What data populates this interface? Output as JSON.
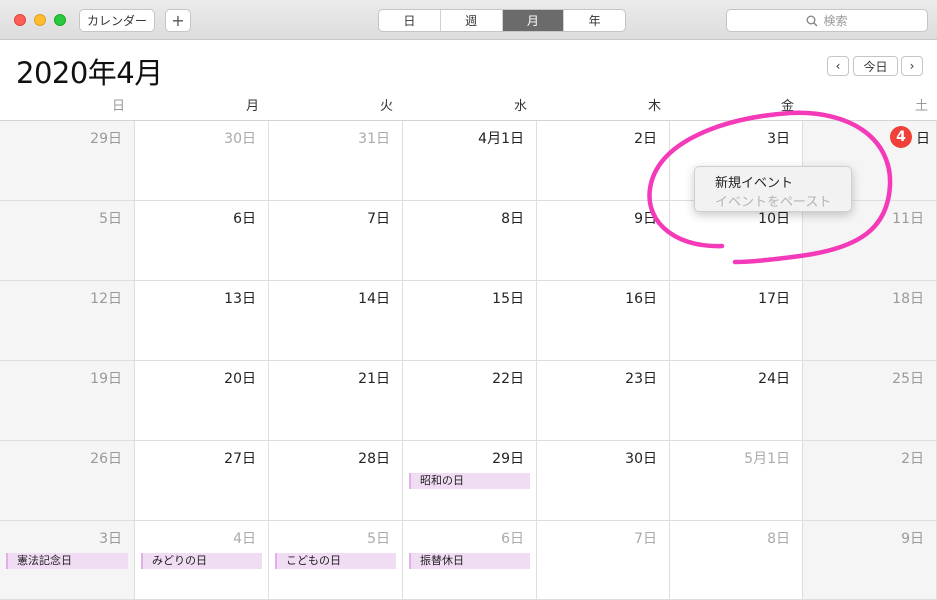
{
  "toolbar": {
    "calendars_label": "カレンダー",
    "add_label": "+",
    "view_tabs": [
      "日",
      "週",
      "月",
      "年"
    ],
    "active_view": "月",
    "search_placeholder": "検索"
  },
  "header": {
    "month_title": "2020年4月",
    "prev_label": "‹",
    "today_label": "今日",
    "next_label": "›"
  },
  "weekdays": [
    "日",
    "月",
    "火",
    "水",
    "木",
    "金",
    "土"
  ],
  "weeks": [
    [
      "29日",
      "30日",
      "31日",
      "4月1日",
      "2日",
      "3日",
      "日"
    ],
    [
      "5日",
      "6日",
      "7日",
      "8日",
      "9日",
      "10日",
      "11日"
    ],
    [
      "12日",
      "13日",
      "14日",
      "15日",
      "16日",
      "17日",
      "18日"
    ],
    [
      "19日",
      "20日",
      "21日",
      "22日",
      "23日",
      "24日",
      "25日"
    ],
    [
      "26日",
      "27日",
      "28日",
      "29日",
      "30日",
      "5月1日",
      "2日"
    ],
    [
      "3日",
      "4日",
      "5日",
      "6日",
      "7日",
      "8日",
      "9日"
    ]
  ],
  "today_badge": "4",
  "events": {
    "showa": "昭和の日",
    "kenpo": "憲法記念日",
    "midori": "みどりの日",
    "kodomo": "こどもの日",
    "furikae": "振替休日"
  },
  "context_menu": {
    "new_event": "新規イベント",
    "paste_event": "イベントをペースト"
  },
  "colors": {
    "today_red": "#f0403a",
    "event_bg": "#f0dcf3",
    "annotation_pink": "#f43ab8",
    "active_tab": "#6b6b6b"
  }
}
